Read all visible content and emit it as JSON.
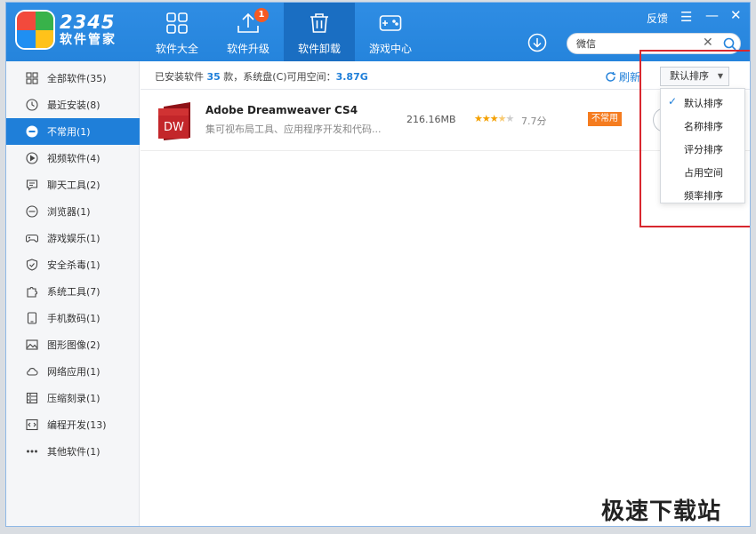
{
  "brand": {
    "number": "2345",
    "name": "软件管家"
  },
  "nav": [
    {
      "label": "软件大全",
      "icon": "grid-icon"
    },
    {
      "label": "软件升级",
      "icon": "upload-icon",
      "badge": "1"
    },
    {
      "label": "软件卸载",
      "icon": "trash-icon",
      "active": true
    },
    {
      "label": "游戏中心",
      "icon": "gamepad-icon"
    }
  ],
  "window": {
    "feedback": "反馈",
    "menu": "☰",
    "minimize": "—",
    "close": "✕"
  },
  "search": {
    "value": "微信",
    "clear": "✕"
  },
  "sidebar": [
    {
      "label": "全部软件(35)",
      "icon": "grid-icon"
    },
    {
      "label": "最近安装(8)",
      "icon": "clock-icon"
    },
    {
      "label": "不常用(1)",
      "icon": "minus-circle-icon",
      "active": true
    },
    {
      "label": "视频软件(4)",
      "icon": "play-icon"
    },
    {
      "label": "聊天工具(2)",
      "icon": "chat-icon"
    },
    {
      "label": "浏览器(1)",
      "icon": "browser-icon"
    },
    {
      "label": "游戏娱乐(1)",
      "icon": "gamepad-icon"
    },
    {
      "label": "安全杀毒(1)",
      "icon": "shield-icon"
    },
    {
      "label": "系统工具(7)",
      "icon": "puzzle-icon"
    },
    {
      "label": "手机数码(1)",
      "icon": "phone-icon"
    },
    {
      "label": "图形图像(2)",
      "icon": "image-icon"
    },
    {
      "label": "网络应用(1)",
      "icon": "cloud-icon"
    },
    {
      "label": "压缩刻录(1)",
      "icon": "archive-icon"
    },
    {
      "label": "编程开发(13)",
      "icon": "code-icon"
    },
    {
      "label": "其他软件(1)",
      "icon": "more-icon"
    }
  ],
  "toolbar": {
    "summary_prefix": "已安装软件 ",
    "installed_count": "35",
    "summary_mid": " 款，系统盘(C)可用空间：",
    "free_space": "3.87G",
    "refresh": "刷新",
    "sort": "默认排序"
  },
  "apps": [
    {
      "name": "Adobe Dreamweaver CS4",
      "description": "集可视布局工具、应用程序开发和代码...",
      "icon_text": "DW",
      "size": "216.16MB",
      "rating": 3.5,
      "score": "7.7分",
      "tag": "不常用"
    }
  ],
  "sort_menu": [
    {
      "label": "默认排序",
      "checked": true
    },
    {
      "label": "名称排序"
    },
    {
      "label": "评分排序"
    },
    {
      "label": "占用空间"
    },
    {
      "label": "频率排序"
    }
  ],
  "colors": {
    "accent": "#1f7fd9",
    "topbar": "#2584dc",
    "tag": "#f57c1f",
    "highlight": "#d8272e"
  },
  "watermark": "极速下载站"
}
